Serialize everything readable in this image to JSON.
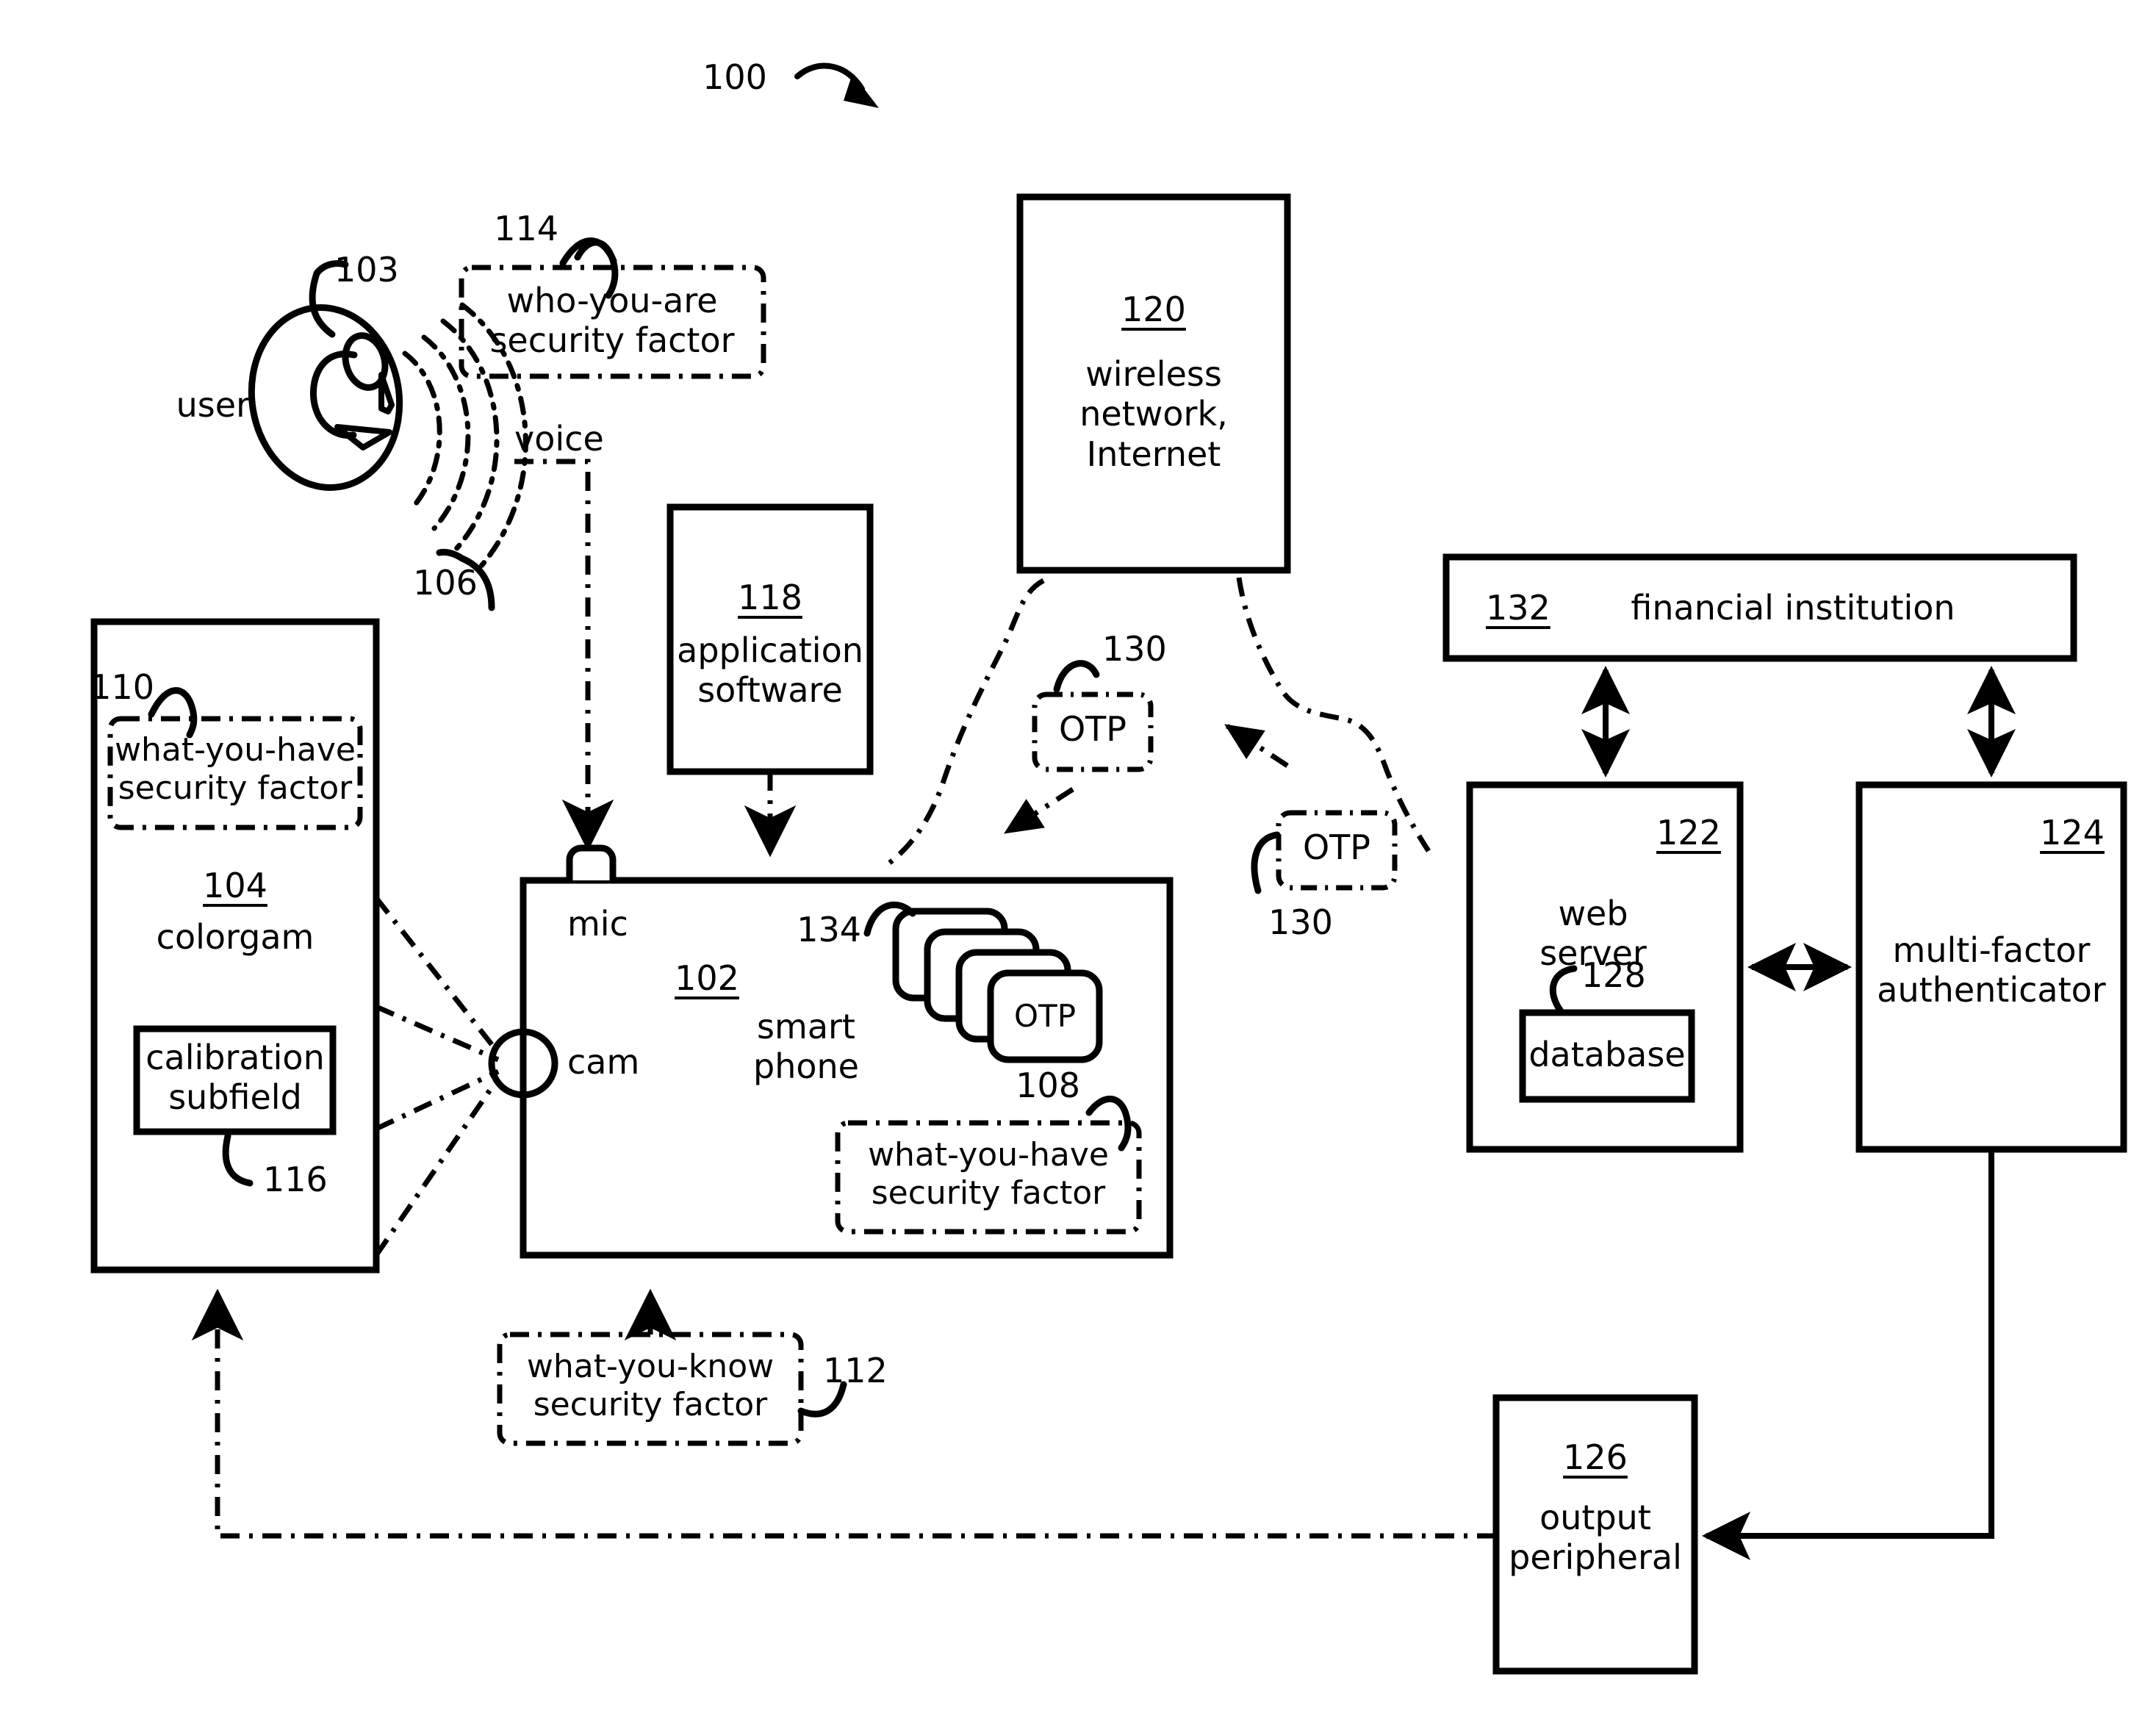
{
  "figure": {
    "figure_number": "100"
  },
  "actors": {
    "user_label": "user",
    "user_ref": "103",
    "voice_label": "voice",
    "voice_ref": "106"
  },
  "boxes": {
    "colorgam": {
      "ref": "104",
      "label": "colorgam",
      "subfield_label": "calibration\nsubfield",
      "subfield_ref": "116",
      "factor_ref": "110",
      "factor_label": "what-you-have\nsecurity factor"
    },
    "smartphone": {
      "ref": "102",
      "label": "smart\nphone",
      "mic_label": "mic",
      "cam_label": "cam",
      "otp_stack_ref": "134",
      "otp_card_label": "OTP",
      "factor_ref": "108",
      "factor_label": "what-you-have\nsecurity factor"
    },
    "application_software": {
      "ref": "118",
      "label": "application\nsoftware"
    },
    "wireless_network": {
      "ref": "120",
      "label": "wireless\nnetwork,\nInternet"
    },
    "financial_institution": {
      "ref": "132",
      "label": "financial institution"
    },
    "web_server": {
      "ref": "122",
      "label": "web\nserver",
      "database_ref": "128",
      "database_label": "database"
    },
    "multi_factor_authenticator": {
      "ref": "124",
      "label": "multi-factor\nauthenticator"
    },
    "output_peripheral": {
      "ref": "126",
      "label": "output\nperipheral"
    }
  },
  "security_factors": {
    "who_you_are": {
      "ref": "114",
      "label": "who-you-are\nsecurity factor"
    },
    "what_you_know": {
      "ref": "112",
      "label": "what-you-know\nsecurity factor"
    }
  },
  "otp_transit": {
    "left": {
      "ref": "130",
      "label": "OTP"
    },
    "right": {
      "ref": "130",
      "label": "OTP"
    }
  },
  "colors": {
    "line": "#000000",
    "background": "#ffffff"
  }
}
